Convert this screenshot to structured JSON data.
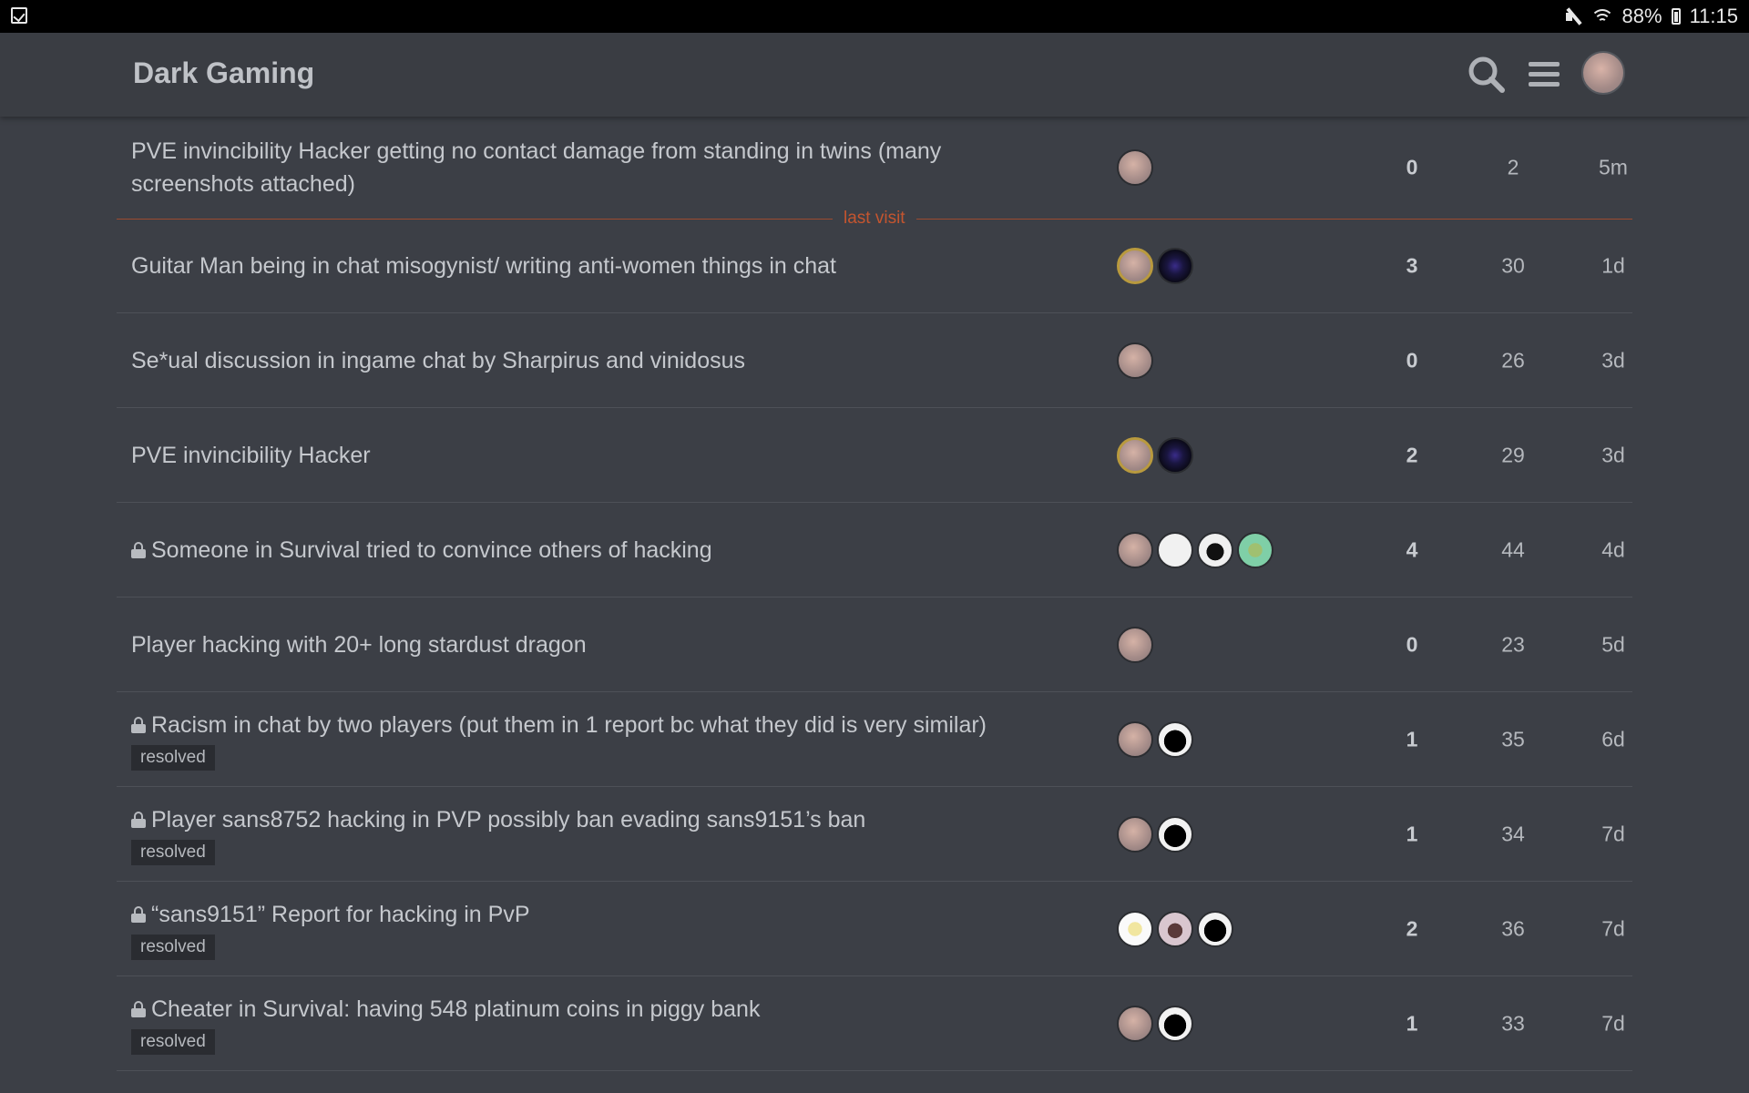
{
  "status_bar": {
    "battery": "88%",
    "time": "11:15"
  },
  "header": {
    "site_title": "Dark Gaming"
  },
  "last_visit_label": "last visit",
  "topics": [
    {
      "title": "PVE invincibility Hacker getting no contact damage from standing in twins (many screenshots attached)",
      "locked": false,
      "tag": "",
      "replies": "0",
      "views": "2",
      "activity": "5m",
      "posters": [
        "op"
      ]
    },
    {
      "title": "Guitar Man being in chat misogynist/ writing anti-women things in chat",
      "locked": false,
      "tag": "",
      "replies": "3",
      "views": "30",
      "activity": "1d",
      "posters": [
        "op-hl",
        "dark-orb"
      ]
    },
    {
      "title": "Se*ual discussion in ingame chat by Sharpirus and vinidosus",
      "locked": false,
      "tag": "",
      "replies": "0",
      "views": "26",
      "activity": "3d",
      "posters": [
        "op"
      ]
    },
    {
      "title": "PVE invincibility Hacker",
      "locked": false,
      "tag": "",
      "replies": "2",
      "views": "29",
      "activity": "3d",
      "posters": [
        "op-hl",
        "dark-orb"
      ]
    },
    {
      "title": "Someone in Survival tried to convince others of hacking",
      "locked": true,
      "tag": "",
      "replies": "4",
      "views": "44",
      "activity": "4d",
      "posters": [
        "op",
        "white-cat",
        "sketch",
        "green"
      ]
    },
    {
      "title": "Player hacking with 20+ long stardust dragon",
      "locked": false,
      "tag": "",
      "replies": "0",
      "views": "23",
      "activity": "5d",
      "posters": [
        "op"
      ]
    },
    {
      "title": "Racism in chat by two players (put them in 1 report bc what they did is very similar)",
      "locked": true,
      "tag": "resolved",
      "replies": "1",
      "views": "35",
      "activity": "6d",
      "posters": [
        "op",
        "black-fig"
      ]
    },
    {
      "title": "Player sans8752 hacking in PVP possibly ban evading sans9151’s ban",
      "locked": true,
      "tag": "resolved",
      "replies": "1",
      "views": "34",
      "activity": "7d",
      "posters": [
        "op",
        "black-fig"
      ]
    },
    {
      "title": "“sans9151” Report for hacking in PvP",
      "locked": true,
      "tag": "resolved",
      "replies": "2",
      "views": "36",
      "activity": "7d",
      "posters": [
        "yellow",
        "bear",
        "black-fig"
      ]
    },
    {
      "title": "Cheater in Survival: having 548 platinum coins in piggy bank",
      "locked": true,
      "tag": "resolved",
      "replies": "1",
      "views": "33",
      "activity": "7d",
      "posters": [
        "op",
        "black-fig"
      ]
    }
  ]
}
